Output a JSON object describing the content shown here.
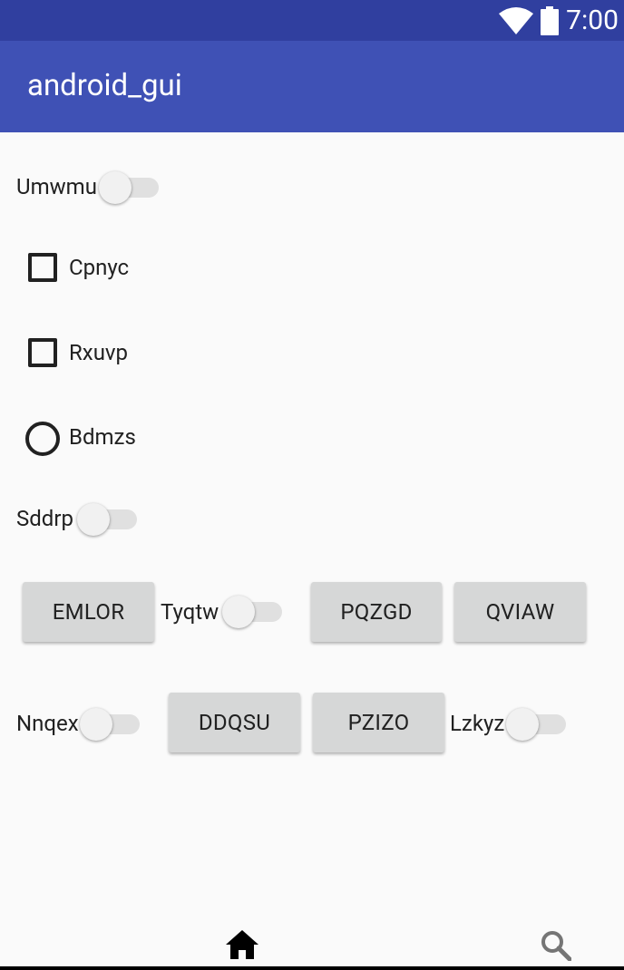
{
  "status_bar": {
    "time": "7:00",
    "icons": [
      "wifi-icon",
      "battery-icon"
    ]
  },
  "app_bar": {
    "title": "android_gui"
  },
  "controls": {
    "umwmu": {
      "label": "Umwmu"
    },
    "cpnyc": {
      "label": "Cpnyc"
    },
    "rxuvp": {
      "label": "Rxuvp"
    },
    "bdmzs": {
      "label": "Bdmzs"
    },
    "sddrp": {
      "label": "Sddrp"
    },
    "emlor": {
      "label": "EMLOR"
    },
    "tyqtw": {
      "label": "Tyqtw"
    },
    "pqzgd": {
      "label": "PQZGD"
    },
    "qviaw": {
      "label": "QVIAW"
    },
    "nnqex": {
      "label": "Nnqex"
    },
    "ddqsu": {
      "label": "DDQSU"
    },
    "pzizo": {
      "label": "PZIZO"
    },
    "lzkyz": {
      "label": "Lzkyz"
    }
  },
  "bottom_nav": {
    "icons": [
      "home-icon",
      "search-icon"
    ]
  },
  "colors": {
    "status_bar": "#303f9f",
    "app_bar": "#3f51b5",
    "background": "#fafafa",
    "button": "#d6d7d7"
  }
}
